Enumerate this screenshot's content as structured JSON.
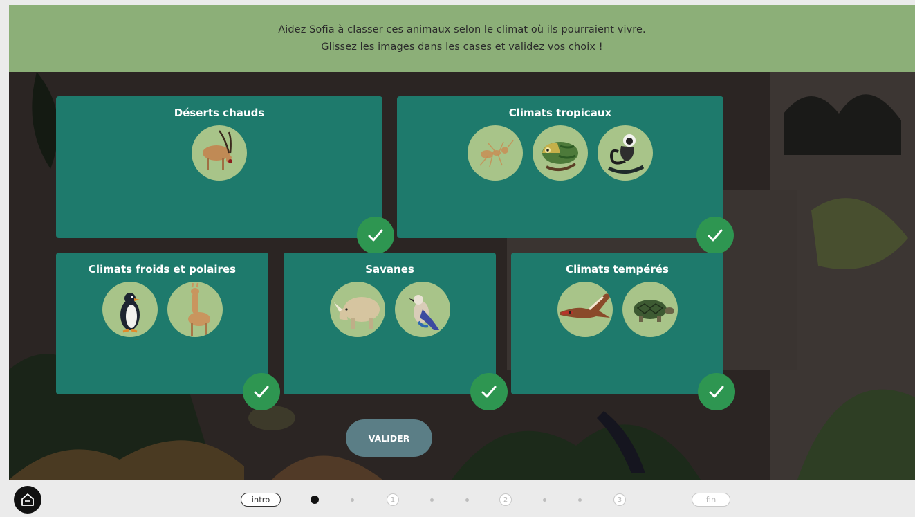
{
  "instructions": {
    "line1": "Aidez Sofia à classer ces animaux selon le climat où ils pourraient vivre.",
    "line2": "Glissez les images dans les cases et validez vos choix !"
  },
  "zones": [
    {
      "title": "Déserts chauds",
      "animals": [
        "antelope"
      ]
    },
    {
      "title": "Climats tropicaux",
      "animals": [
        "ant",
        "chameleon",
        "monkey"
      ]
    },
    {
      "title": "Climats froids et polaires",
      "animals": [
        "penguin",
        "llama"
      ]
    },
    {
      "title": "Savanes",
      "animals": [
        "rhinoceros",
        "bird"
      ]
    },
    {
      "title": "Climats tempérés",
      "animals": [
        "bird-of-prey",
        "tortoise"
      ]
    }
  ],
  "validate_label": "VALIDER",
  "progress": {
    "start_label": "intro",
    "steps": [
      "1",
      "2",
      "3"
    ],
    "end_label": "fin"
  },
  "colors": {
    "banner": "#8caf78",
    "zone": "#1e7a6c",
    "check": "#2e9651",
    "button": "#5b7e86",
    "animal_circle": "#a8c489"
  },
  "icons": {
    "home": "home-icon",
    "check": "check-icon"
  }
}
